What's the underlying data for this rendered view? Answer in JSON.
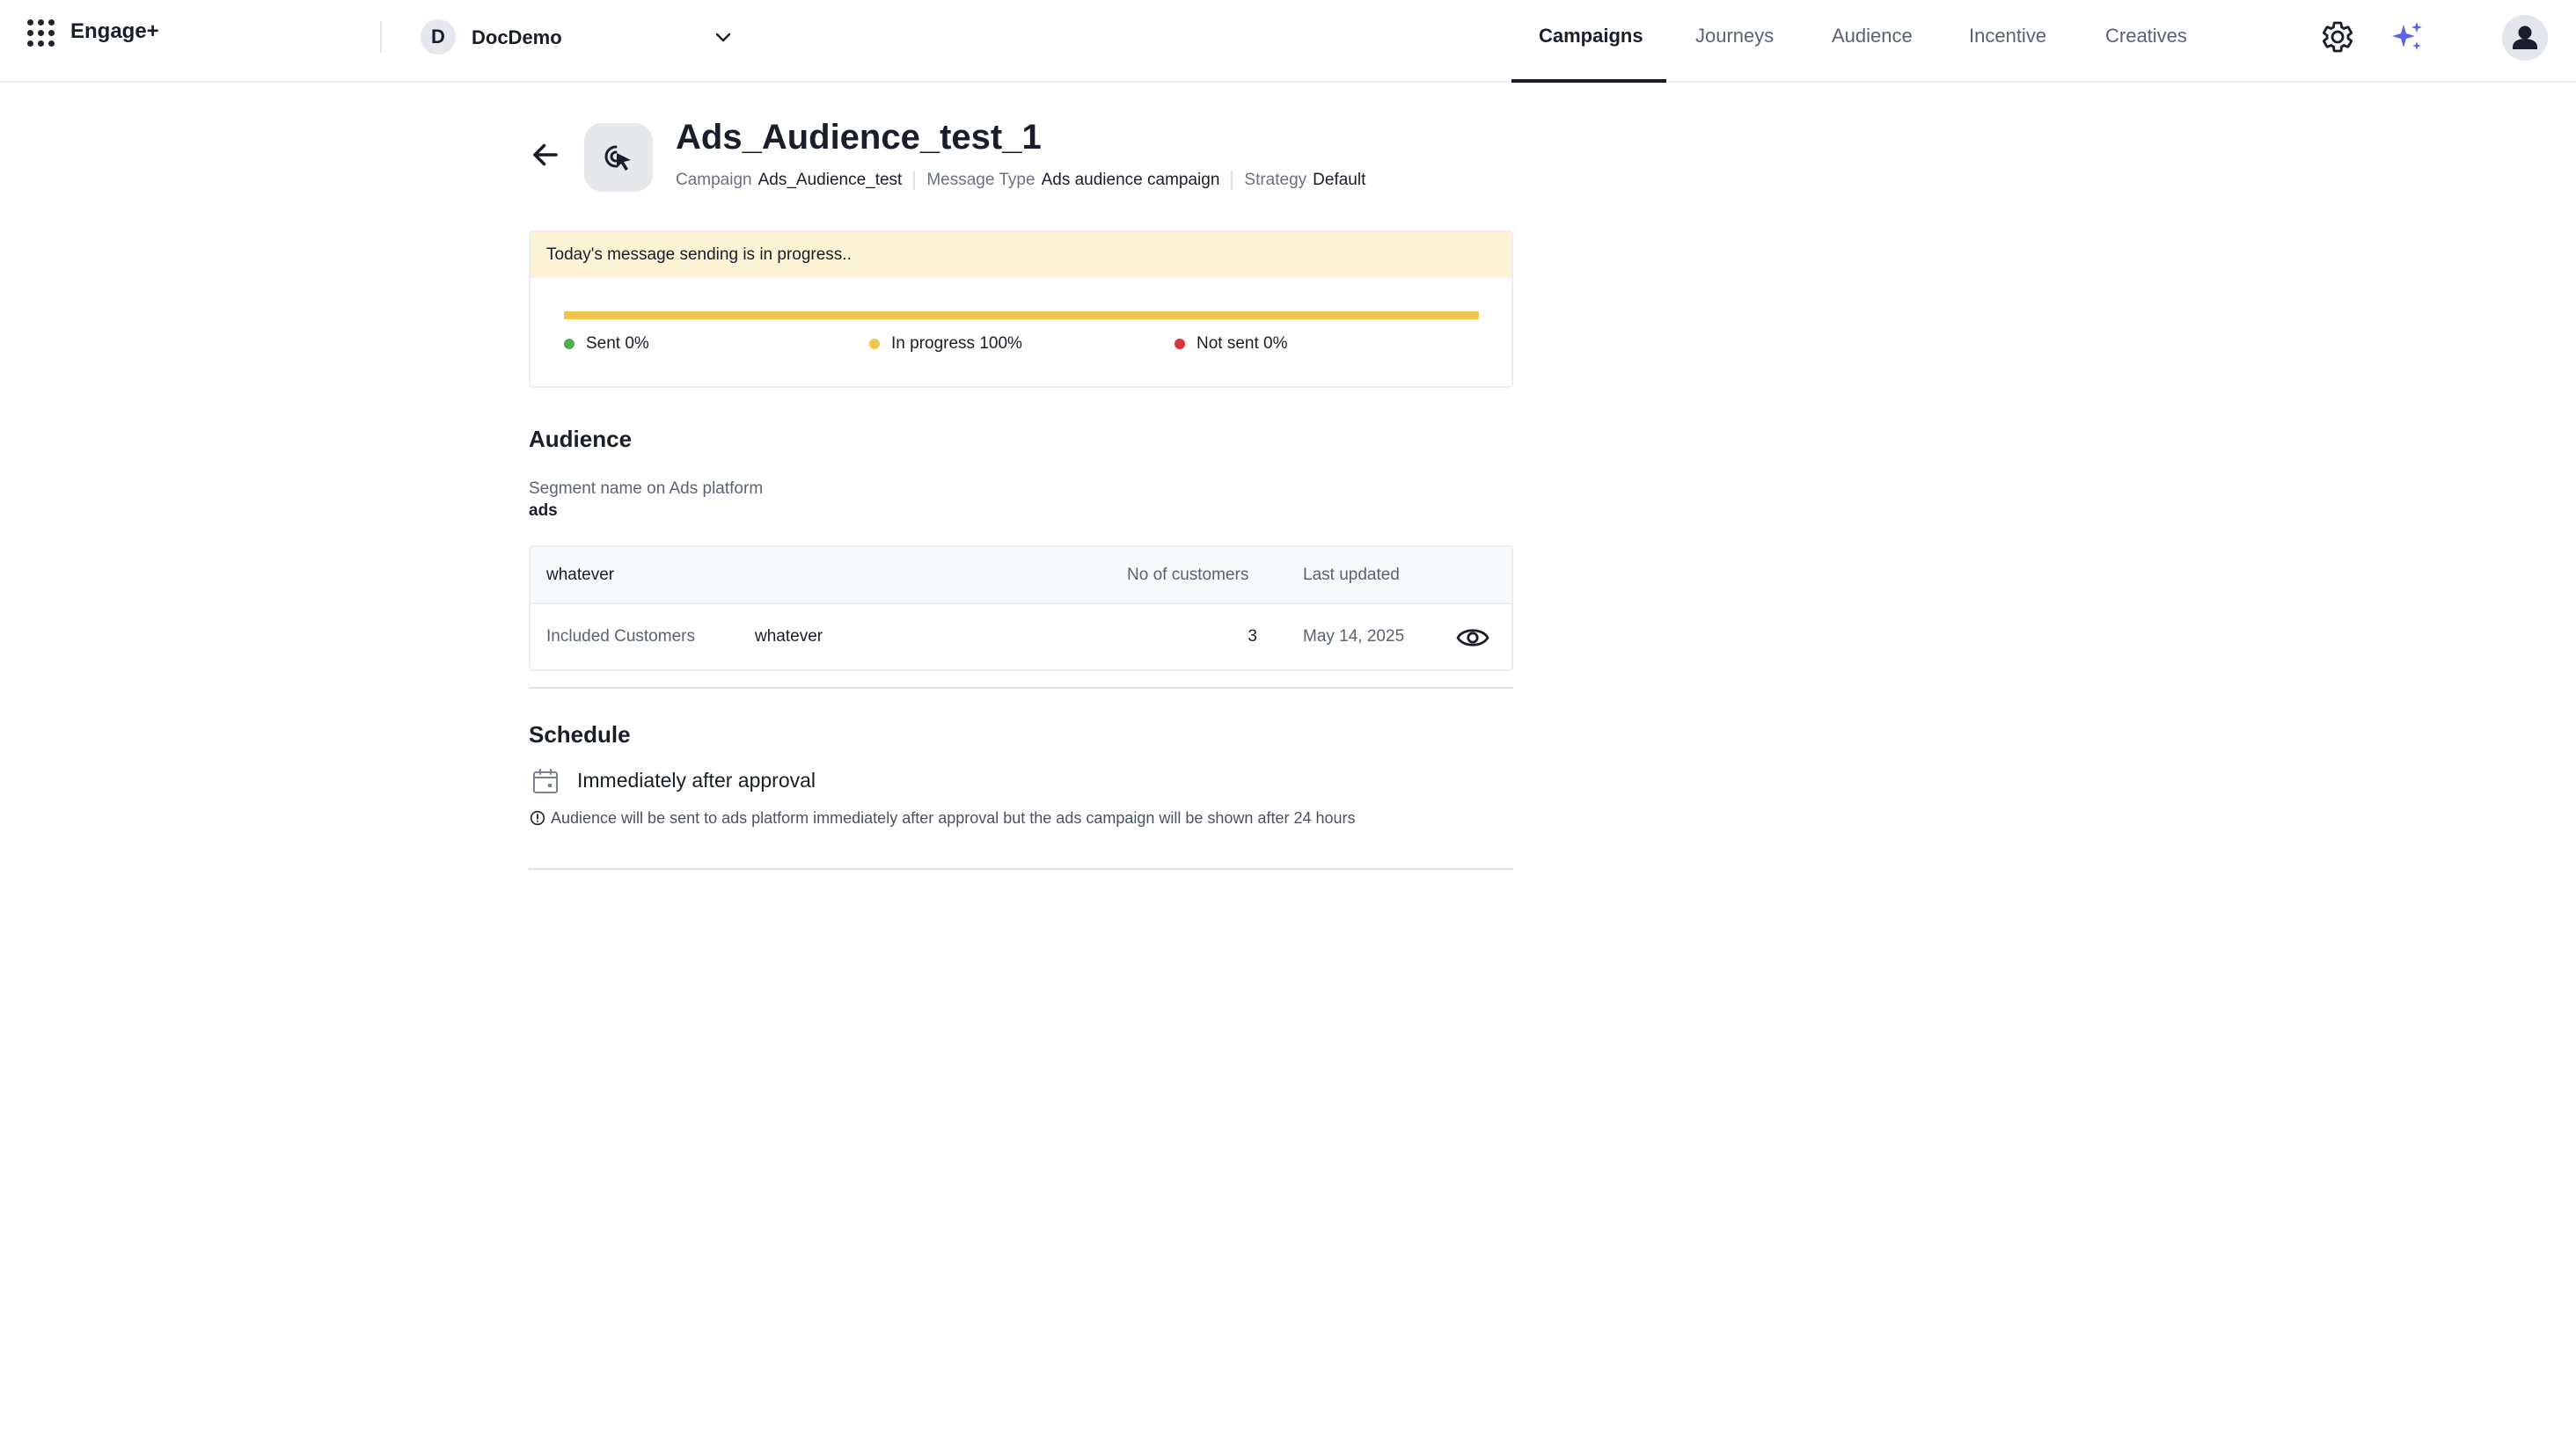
{
  "header": {
    "brand": "Engage+",
    "workspace": {
      "initial": "D",
      "name": "DocDemo"
    },
    "tabs": [
      {
        "label": "Campaigns",
        "active": true
      },
      {
        "label": "Journeys",
        "active": false
      },
      {
        "label": "Audience",
        "active": false
      },
      {
        "label": "Incentive",
        "active": false
      },
      {
        "label": "Creatives",
        "active": false
      }
    ],
    "icons": [
      "apps-grid-icon",
      "chevron-down-icon",
      "gear-icon",
      "sparkle-icon",
      "user-icon"
    ]
  },
  "campaign": {
    "title": "Ads_Audience_test_1",
    "icon": "cursor-click-icon",
    "meta": [
      {
        "key": "Campaign",
        "value": "Ads_Audience_test"
      },
      {
        "key": "Message Type",
        "value": "Ads audience campaign"
      },
      {
        "key": "Strategy",
        "value": "Default"
      }
    ]
  },
  "progress": {
    "banner": "Today's message sending is in progress..",
    "fill_percent": 100,
    "fill_color": "#f1c54b",
    "legend": [
      {
        "label": "Sent 0%",
        "color": "#4caf50"
      },
      {
        "label": "In progress 100%",
        "color": "#f1c54b"
      },
      {
        "label": "Not sent 0%",
        "color": "#d9343a"
      }
    ]
  },
  "audience": {
    "title": "Audience",
    "segment_label": "Segment name on Ads platform",
    "segment_value": "ads",
    "table": {
      "headers": [
        "whatever",
        "No of customers",
        "Last updated"
      ],
      "rows": [
        {
          "type": "Included Customers",
          "name": "whatever",
          "count": "3",
          "updated": "May 14, 2025",
          "action_icon": "eye-icon"
        }
      ]
    }
  },
  "schedule": {
    "title": "Schedule",
    "icon": "calendar-icon",
    "value": "Immediately after approval",
    "note_icon": "info-icon",
    "note": "Audience will be sent to ads platform immediately after approval but the ads campaign will be shown after 24 hours"
  }
}
